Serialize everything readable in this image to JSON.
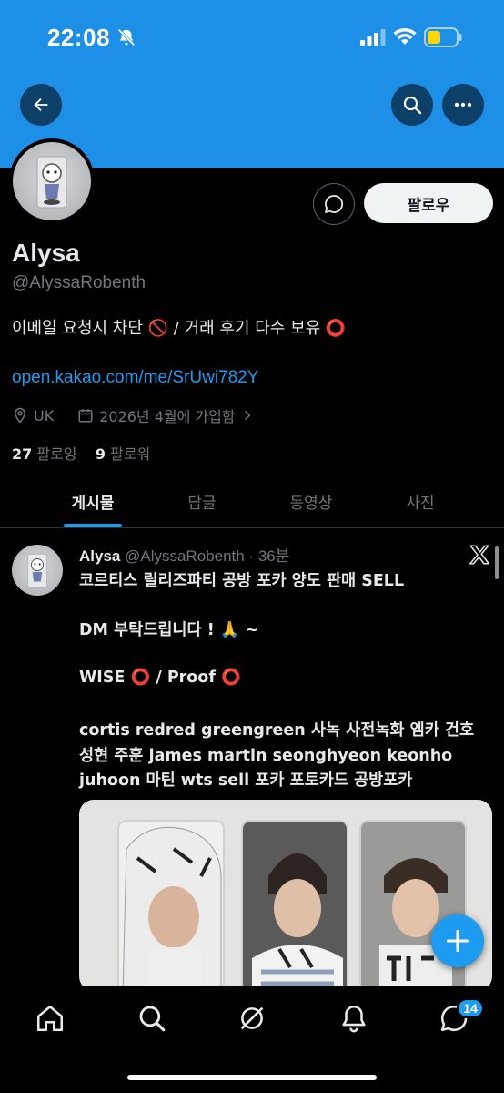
{
  "status_bar": {
    "time": "22:08"
  },
  "profile": {
    "display_name": "Alysa",
    "handle": "@AlyssaRobenth",
    "bio": "이메일 요청시 차단 🚫 / 거래 후기 다수 보유 ⭕",
    "link": "open.kakao.com/me/SrUwi782Y",
    "location": "UK",
    "joined": "2026년 4월에 가입함",
    "following_count": "27",
    "following_label": "팔로잉",
    "followers_count": "9",
    "followers_label": "팔로워",
    "follow_button": "팔로우"
  },
  "tabs": [
    {
      "label": "게시물",
      "active": true
    },
    {
      "label": "답글",
      "active": false
    },
    {
      "label": "동영상",
      "active": false
    },
    {
      "label": "사진",
      "active": false
    }
  ],
  "post": {
    "name": "Alysa",
    "handle_time": "@AlyssaRobenth · 36분",
    "lines": [
      "코르티스 릴리즈파티 공방 포카 양도 판매 SELL",
      "DM 부탁드립니다 ! 🙏 ~",
      "WISE ⭕ / Proof ⭕",
      "cortis redred greengreen 사녹 사전녹화 엠카 건호",
      "성현 주훈 james martin seonghyeon keonho",
      "juhoon 마틴 wts sell 포카 포토카드 공방포카"
    ]
  },
  "nav": {
    "items": [
      "home-icon",
      "search-icon",
      "grok-icon",
      "notifications-icon",
      "messages-icon"
    ],
    "messages_badge": "14"
  },
  "colors": {
    "banner": "#1d8fe6",
    "accent": "#1d9bf0",
    "background": "#000000"
  }
}
